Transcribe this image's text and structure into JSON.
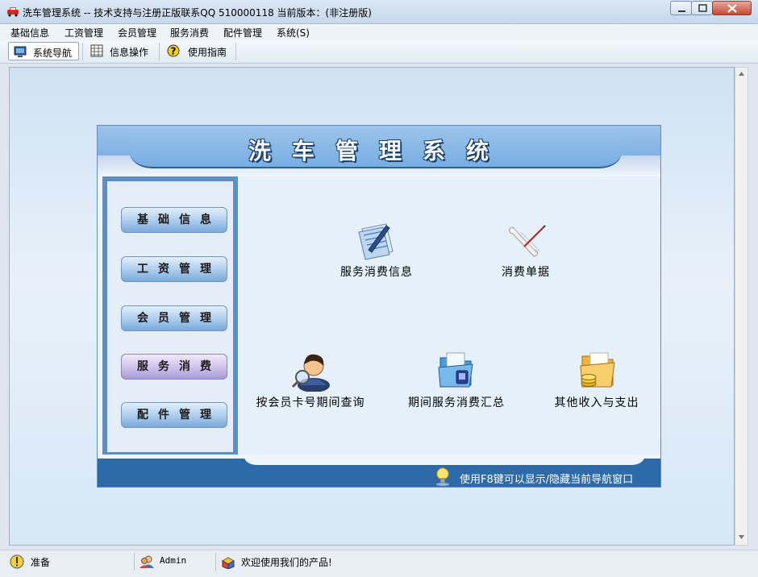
{
  "window": {
    "title": "洗车管理系统 -- 技术支持与注册正版联系QQ 510000118    当前版本：(非注册版)"
  },
  "menu": {
    "items": [
      "基础信息",
      "工资管理",
      "会员管理",
      "服务消费",
      "配件管理",
      "系统(S)"
    ]
  },
  "toolbar": {
    "buttons": [
      {
        "label": "系统导航",
        "active": true
      },
      {
        "label": "信息操作",
        "active": false
      },
      {
        "label": "使用指南",
        "active": false
      }
    ]
  },
  "panel": {
    "title": "洗车管理系统",
    "sidebar": [
      {
        "label": "基础信息",
        "active": false
      },
      {
        "label": "工资管理",
        "active": false
      },
      {
        "label": "会员管理",
        "active": false
      },
      {
        "label": "服务消费",
        "active": true
      },
      {
        "label": "配件管理",
        "active": false
      }
    ],
    "features": [
      {
        "label": "服务消费信息",
        "icon": "document-pen-icon"
      },
      {
        "label": "消费单据",
        "icon": "scroll-icon"
      },
      {
        "label": "按会员卡号期间查询",
        "icon": "user-search-icon"
      },
      {
        "label": "期间服务消费汇总",
        "icon": "folder-document-icon"
      },
      {
        "label": "其他收入与支出",
        "icon": "folder-coins-icon"
      }
    ],
    "footer_hint": "使用F8键可以显示/隐藏当前导航窗口"
  },
  "status": {
    "state": "准备",
    "user": "Admin",
    "welcome": "欢迎使用我们的产品!"
  },
  "colors": {
    "header_blue": "#6ea6df",
    "footer_blue": "#2e6aa9",
    "active_tab_purple": "#a69ad8"
  }
}
